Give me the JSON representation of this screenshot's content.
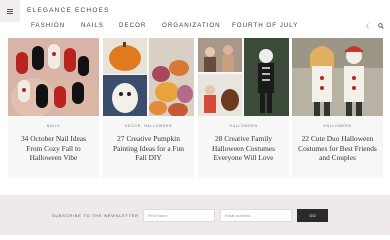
{
  "header": {
    "brand": "ELEGANCE ECHOES",
    "nav": [
      "FASHION",
      "NAILS",
      "DECOR",
      "ORGANIZATION",
      "FOURTH OF JULY"
    ]
  },
  "icons": {
    "menu": "hamburger-icon",
    "theme": "moon-icon",
    "search": "search-icon"
  },
  "cards": [
    {
      "category": "NAILS",
      "title": "34 October Nail Ideas From Cozy Fall to Halloween Vibe"
    },
    {
      "category": "DECOR, HALLOWEEN",
      "title": "27 Creative Pumpkin Painting Ideas for a Fun Fall DIY"
    },
    {
      "category": "HALLOWEEN",
      "title": "28 Creative Family Halloween Costumes Everyone Will Love"
    },
    {
      "category": "HALLOWEEN",
      "title": "22 Cute Duo Halloween Costumes for Best Friends and Couples"
    }
  ],
  "newsletter": {
    "label": "SUBSCRIBE TO THE NEWSLETTER",
    "first_name_placeholder": "First Name",
    "email_placeholder": "Email address",
    "button": "GO"
  }
}
